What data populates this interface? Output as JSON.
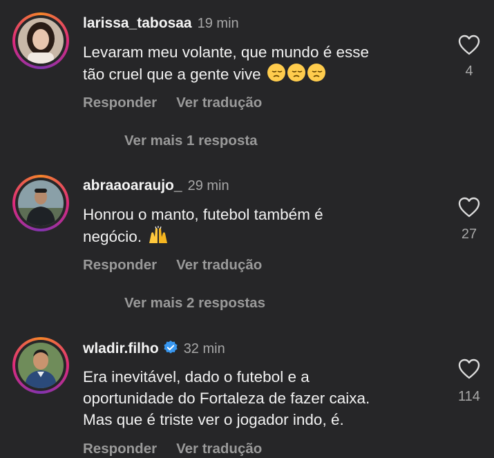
{
  "actions": {
    "reply": "Responder",
    "translate": "Ver tradução"
  },
  "comments": [
    {
      "username": "larissa_tabosaa",
      "time": "19 min",
      "text_line1": "Levaram meu volante, que mundo é esse",
      "text_line2": "tão cruel que a gente vive",
      "emoji": "pensive-face x3",
      "likes": "4",
      "more_replies": "Ver mais 1 resposta"
    },
    {
      "username": "abraaoaraujo_",
      "time": "29 min",
      "text_line1": "Honrou o manto, futebol também é",
      "text_line2": "negócio.",
      "emoji": "raising-hands",
      "likes": "27",
      "more_replies": "Ver mais 2 respostas"
    },
    {
      "username": "wladir.filho",
      "verified": true,
      "time": "32 min",
      "text_line1": "Era inevitável, dado o futebol e a",
      "text_line2": "oportunidade do Fortaleza de fazer caixa.",
      "text_line3": "Mas que é triste ver o jogador indo, é.",
      "likes": "114"
    }
  ],
  "colors": {
    "background": "#262628",
    "verified": "#3897f0",
    "muted": "#a8a8a8"
  }
}
